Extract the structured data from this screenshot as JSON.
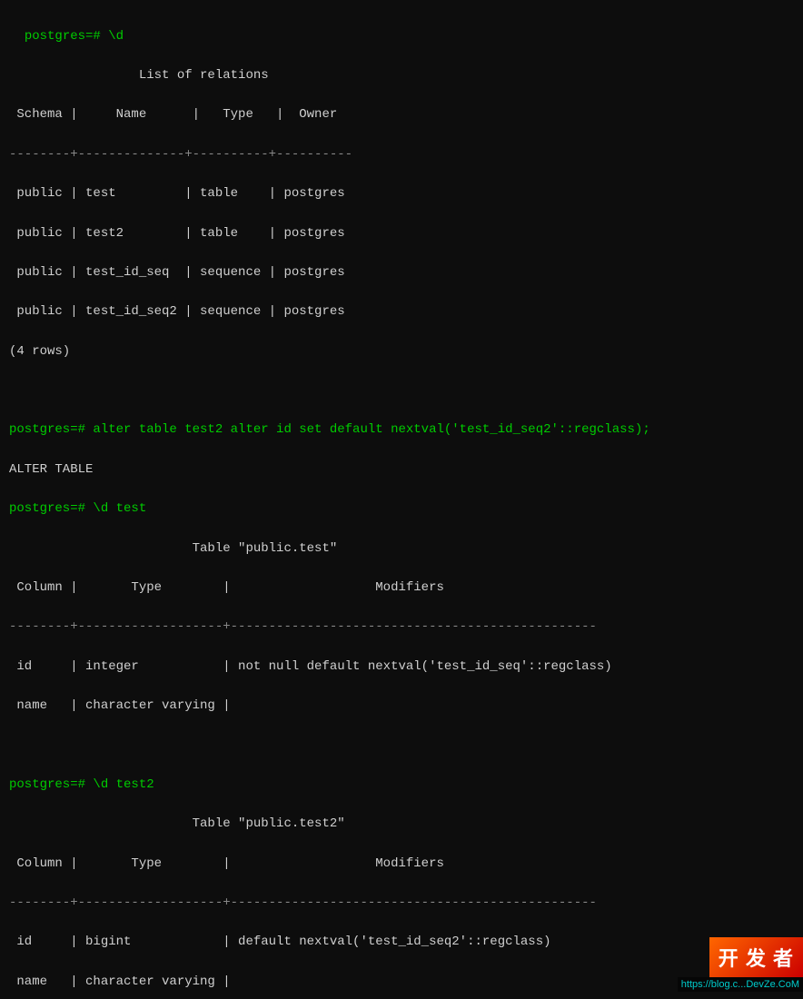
{
  "terminal": {
    "lines": [
      {
        "type": "prompt",
        "text": "postgres=# \\d"
      },
      {
        "type": "output",
        "text": "                 List of relations"
      },
      {
        "type": "output",
        "text": " Schema |     Name      |   Type   |  Owner   "
      },
      {
        "type": "separator",
        "text": "--------+--------------+----------+----------"
      },
      {
        "type": "output",
        "text": " public | test         | table    | postgres "
      },
      {
        "type": "output",
        "text": " public | test2        | table    | postgres "
      },
      {
        "type": "output",
        "text": " public | test_id_seq  | sequence | postgres "
      },
      {
        "type": "output",
        "text": " public | test_id_seq2 | sequence | postgres "
      },
      {
        "type": "output",
        "text": "(4 rows)"
      },
      {
        "type": "blank",
        "text": ""
      },
      {
        "type": "prompt",
        "text": "postgres=# alter table test2 alter id set default nextval('test_id_seq2'::regclass);"
      },
      {
        "type": "output",
        "text": "ALTER TABLE"
      },
      {
        "type": "prompt",
        "text": "postgres=# \\d test"
      },
      {
        "type": "output",
        "text": "                        Table \"public.test\""
      },
      {
        "type": "output",
        "text": " Column |       Type        |                   Modifiers                    "
      },
      {
        "type": "separator",
        "text": "--------+-------------------+------------------------------------------------"
      },
      {
        "type": "output",
        "text": " id     | integer           | not null default nextval('test_id_seq'::regclass)"
      },
      {
        "type": "output",
        "text": " name   | character varying |"
      },
      {
        "type": "blank",
        "text": ""
      },
      {
        "type": "prompt",
        "text": "postgres=# \\d test2"
      },
      {
        "type": "output",
        "text": "                        Table \"public.test2\""
      },
      {
        "type": "output",
        "text": " Column |       Type        |                   Modifiers                    "
      },
      {
        "type": "separator",
        "text": "--------+-------------------+------------------------------------------------"
      },
      {
        "type": "output",
        "text": " id     | bigint            | default nextval('test_id_seq2'::regclass)"
      },
      {
        "type": "output",
        "text": " name   | character varying |"
      }
    ]
  },
  "watermark": {
    "badge": "开 发 者",
    "url": "https://blog.c...DevZe.CoM"
  }
}
